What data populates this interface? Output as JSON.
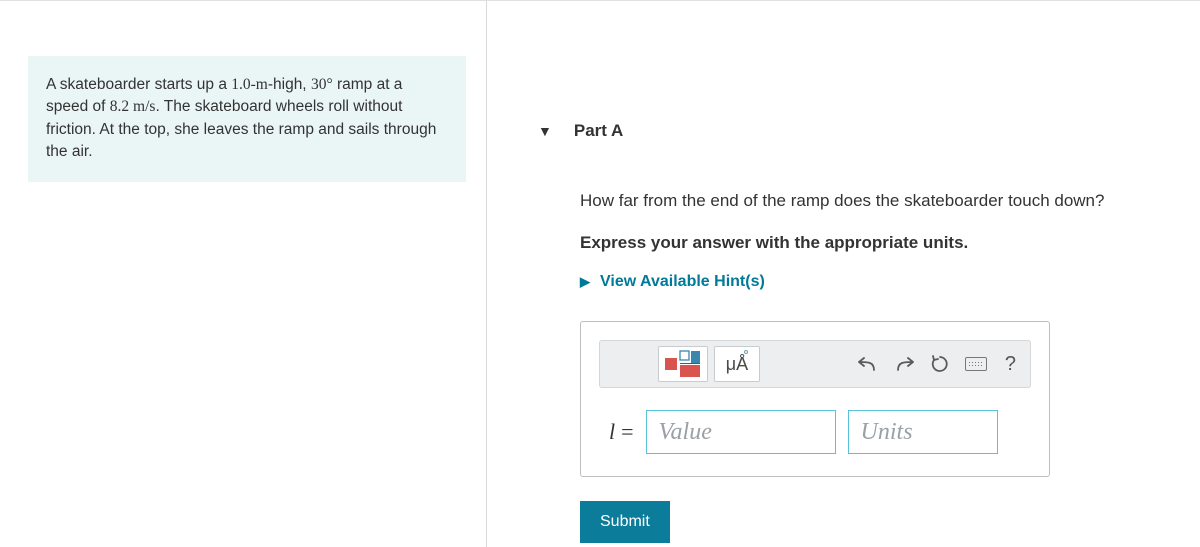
{
  "problem": {
    "text_before_height": "A skateboarder starts up a ",
    "height": "1.0-m",
    "text_mid1": "-high, ",
    "angle": "30°",
    "text_mid2": " ramp at a speed of ",
    "speed": "8.2 m/s",
    "text_after": ". The skateboard wheels roll without friction. At the top, she leaves the ramp and sails through the air."
  },
  "part": {
    "label": "Part A",
    "question": "How far from the end of the ramp does the skateboarder touch down?",
    "instruction": "Express your answer with the appropriate units.",
    "hints_label": "View Available Hint(s)",
    "variable": "l",
    "equals": "=",
    "value_placeholder": "Value",
    "units_placeholder": "Units",
    "toolbar": {
      "special": "μÅ",
      "help": "?"
    },
    "submit": "Submit"
  }
}
